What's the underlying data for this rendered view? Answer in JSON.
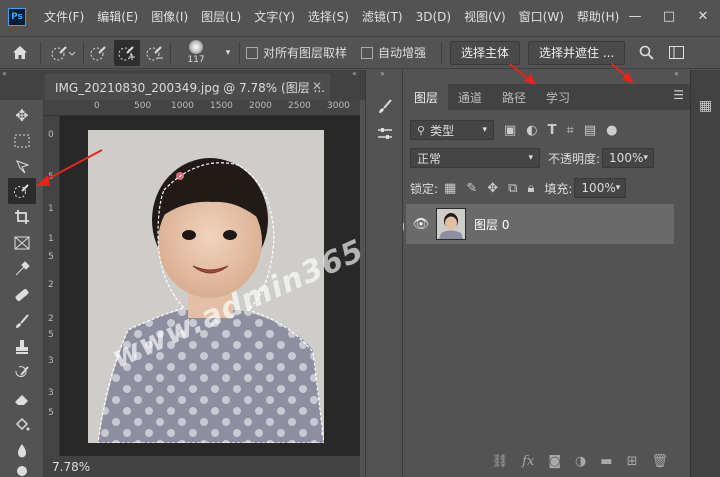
{
  "app": {
    "logo": "Ps"
  },
  "menu": [
    "文件(F)",
    "编辑(E)",
    "图像(I)",
    "图层(L)",
    "文字(Y)",
    "选择(S)",
    "滤镜(T)",
    "3D(D)",
    "视图(V)",
    "窗口(W)",
    "帮助(H)"
  ],
  "window_controls": {
    "minimize": "—",
    "maximize": "□",
    "close": "✕"
  },
  "options": {
    "brush_size": "117",
    "sample_all_layers": "对所有图层取样",
    "auto_enhance": "自动增强",
    "select_subject": "选择主体",
    "select_and_mask": "选择并遮住 ..."
  },
  "document": {
    "tab_title": "IMG_20210830_200349.jpg @ 7.78% (图层 ...",
    "zoom": "7.78%",
    "ruler_h": [
      "0",
      "500",
      "1000",
      "1500",
      "2000",
      "2500",
      "3000"
    ],
    "ruler_v": [
      "0",
      "5",
      "1",
      "1",
      "5",
      "2",
      "2",
      "5",
      "3",
      "3",
      "5"
    ]
  },
  "watermark": "www.admin365.cn",
  "layers_panel": {
    "tabs": [
      "图层",
      "通道",
      "路径",
      "学习"
    ],
    "filter_kind": "类型",
    "blend_mode": "正常",
    "opacity_label": "不透明度:",
    "opacity_value": "100%",
    "lock_label": "锁定:",
    "fill_label": "填充:",
    "fill_value": "100%",
    "layers": [
      {
        "name": "图层 0"
      }
    ]
  },
  "colors": {
    "accent_arrow": "#e8231d",
    "panel_bg": "#535353",
    "canvas_bg": "#282828"
  }
}
